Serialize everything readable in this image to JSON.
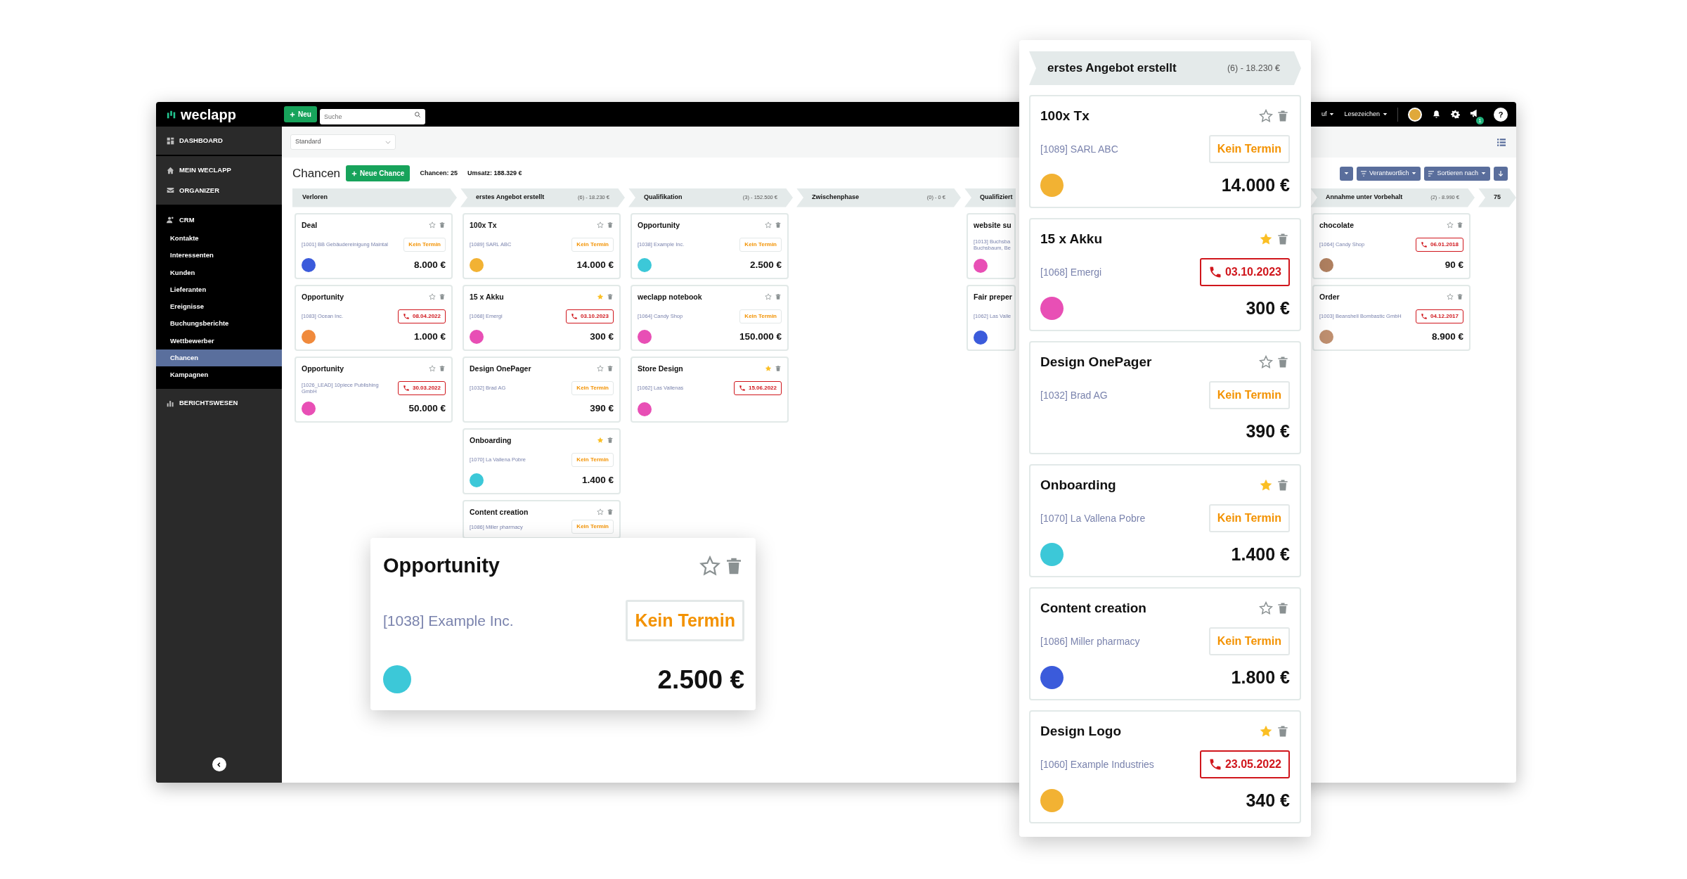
{
  "app": {
    "topbar": {
      "logo": "weclapp",
      "new_button": "Neu",
      "search": {
        "placeholder": "Suche"
      },
      "menus": [
        "uf",
        "Lesezeichen"
      ],
      "announcement_badge": "1",
      "help": "?"
    },
    "sidebar": {
      "groups": [
        {
          "items": [
            {
              "label": "DASHBOARD",
              "selected": false
            }
          ]
        },
        {
          "items": [
            {
              "label": "MEIN WECLAPP",
              "selected": false
            },
            {
              "label": "ORGANIZER",
              "selected": false
            }
          ]
        },
        {
          "items": [
            {
              "label": "CRM",
              "selected": false,
              "expanded": true,
              "children": [
                {
                  "label": "Kontakte",
                  "selected": false
                },
                {
                  "label": "Interessenten",
                  "selected": false
                },
                {
                  "label": "Kunden",
                  "selected": false
                },
                {
                  "label": "Lieferanten",
                  "selected": false
                },
                {
                  "label": "Ereignisse",
                  "selected": false
                },
                {
                  "label": "Buchungsberichte",
                  "selected": false
                },
                {
                  "label": "Wettbewerber",
                  "selected": false
                },
                {
                  "label": "Chancen",
                  "selected": true
                },
                {
                  "label": "Kampagnen",
                  "selected": false
                }
              ]
            }
          ]
        },
        {
          "items": [
            {
              "label": "BERICHTSWESEN",
              "selected": false
            }
          ]
        }
      ]
    },
    "view_select": {
      "value": "Standard"
    },
    "header": {
      "title": "Chancen",
      "new_button": "Neue Chance",
      "stats": [
        "Chancen: 25",
        "Umsatz: 188.329 €"
      ]
    },
    "filters": [
      {
        "kind": "dropdown"
      },
      {
        "kind": "filter",
        "label": "Verantwortlich"
      },
      {
        "kind": "sort",
        "label": "Sortieren nach"
      },
      {
        "kind": "download"
      }
    ],
    "stages": [
      {
        "name": "Verloren",
        "cards": [
          {
            "title": "Deal",
            "company": "[1001] BB Gebäudereinigung Maintal",
            "starred": false,
            "appointment": {
              "kind": "none",
              "text": "Kein Termin"
            },
            "avatar": {
              "color": "#3b5bdb"
            },
            "amount": "8.000 €"
          },
          {
            "title": "Opportunity",
            "company": "[1083] Ocean Inc.",
            "starred": false,
            "appointment": {
              "kind": "call",
              "text": "08.04.2022"
            },
            "avatar": {
              "color": "#f08a3c"
            },
            "amount": "1.000 €"
          },
          {
            "title": "Opportunity",
            "company": "[1026_LEAD] 10piece Publishing GmbH",
            "starred": false,
            "appointment": {
              "kind": "call",
              "text": "30.03.2022"
            },
            "avatar": {
              "color": "#e84fb5"
            },
            "amount": "50.000 €"
          }
        ]
      },
      {
        "name": "erstes Angebot erstellt",
        "summary": "(6) - 18.230 €",
        "cards": [
          {
            "title": "100x Tx",
            "company": "[1089] SARL ABC",
            "starred": false,
            "appointment": {
              "kind": "none",
              "text": "Kein Termin"
            },
            "avatar": {
              "color": "#f2b233"
            },
            "amount": "14.000 €"
          },
          {
            "title": "15 x Akku",
            "company": "[1068] Emergi",
            "starred": true,
            "appointment": {
              "kind": "call",
              "text": "03.10.2023"
            },
            "avatar": {
              "color": "#e84fb5"
            },
            "amount": "300 €"
          },
          {
            "title": "Design OnePager",
            "company": "[1032] Brad AG",
            "starred": false,
            "appointment": {
              "kind": "none",
              "text": "Kein Termin"
            },
            "amount": "390 €"
          },
          {
            "title": "Onboarding",
            "company": "[1070] La Vallena Pobre",
            "starred": true,
            "appointment": {
              "kind": "none",
              "text": "Kein Termin"
            },
            "avatar": {
              "color": "#3cc8d8"
            },
            "amount": "1.400 €"
          },
          {
            "title": "Content creation",
            "company": "[1086] Miller pharmacy",
            "starred": false,
            "appointment": {
              "kind": "none",
              "text": "Kein Termin"
            }
          }
        ]
      },
      {
        "name": "Qualifikation",
        "summary": "(3) - 152.500 €",
        "cards": [
          {
            "title": "Opportunity",
            "company": "[1038] Example Inc.",
            "starred": false,
            "appointment": {
              "kind": "none",
              "text": "Kein Termin"
            },
            "avatar": {
              "color": "#3cc8d8"
            },
            "amount": "2.500 €"
          },
          {
            "title": "weclapp notebook",
            "company": "[1064] Candy Shop",
            "starred": false,
            "appointment": {
              "kind": "none",
              "text": "Kein Termin"
            },
            "avatar": {
              "color": "#e84fb5"
            },
            "amount": "150.000 €"
          },
          {
            "title": "Store Design",
            "company": "[1062] Las Vallenas",
            "starred": true,
            "appointment": {
              "kind": "call",
              "text": "15.06.2022"
            },
            "avatar": {
              "color": "#e84fb5"
            }
          }
        ]
      },
      {
        "name": "Zwischenphase",
        "summary": "(0) - 0 €"
      },
      {
        "name": "Qualifiziert",
        "cards": [
          {
            "title": "website su",
            "company": "[1013] Buchsba\nBuchsbaum, Be",
            "avatar": {
              "color": "#e84fb5"
            }
          },
          {
            "title": "Fair preper",
            "company": "[1062] Las Valle",
            "avatar": {
              "color": "#3b5bdb"
            }
          }
        ]
      },
      {
        "name": "Annahme unter Vorbehalt",
        "summary": "(2) - 8.990 €",
        "cards": [
          {
            "title": "chocolate",
            "company": "[1064] Candy Shop",
            "starred": false,
            "appointment": {
              "kind": "call",
              "text": "06.01.2018"
            },
            "avatar": {
              "color": "#b08060"
            },
            "amount": "90 €"
          },
          {
            "title": "Order",
            "company": "[1003] Beanshell Bombastic GmbH",
            "starred": false,
            "appointment": {
              "kind": "call",
              "text": "04.12.2017"
            },
            "avatar": {
              "color": "#c09070"
            },
            "amount": "8.900 €"
          }
        ]
      },
      {
        "name": "75"
      }
    ]
  },
  "zoom_card": {
    "title": "Opportunity",
    "company": "[1038] Example Inc.",
    "starred": false,
    "appointment": {
      "kind": "none",
      "text": "Kein Termin"
    },
    "avatar": {
      "color": "#3cc8d8"
    },
    "amount": "2.500 €"
  },
  "stage_panel": {
    "name": "erstes Angebot erstellt",
    "summary": "(6) - 18.230 €",
    "cards": [
      {
        "title": "100x Tx",
        "company": "[1089] SARL ABC",
        "starred": false,
        "appointment": {
          "kind": "none",
          "text": "Kein Termin"
        },
        "avatar": {
          "color": "#f2b233"
        },
        "amount": "14.000 €"
      },
      {
        "title": "15 x Akku",
        "company": "[1068] Emergi",
        "starred": true,
        "appointment": {
          "kind": "call",
          "text": "03.10.2023"
        },
        "avatar": {
          "color": "#e84fb5"
        },
        "amount": "300 €"
      },
      {
        "title": "Design OnePager",
        "company": "[1032] Brad AG",
        "starred": false,
        "appointment": {
          "kind": "none",
          "text": "Kein Termin"
        },
        "amount": "390 €"
      },
      {
        "title": "Onboarding",
        "company": "[1070] La Vallena Pobre",
        "starred": true,
        "appointment": {
          "kind": "none",
          "text": "Kein Termin"
        },
        "avatar": {
          "color": "#3cc8d8"
        },
        "amount": "1.400 €"
      },
      {
        "title": "Content creation",
        "company": "[1086] Miller pharmacy",
        "starred": false,
        "appointment": {
          "kind": "none",
          "text": "Kein Termin"
        },
        "avatar": {
          "color": "#3b5bdb"
        },
        "amount": "1.800 €"
      },
      {
        "title": "Design Logo",
        "company": "[1060] Example Industries",
        "starred": true,
        "appointment": {
          "kind": "call",
          "text": "23.05.2022"
        },
        "avatar": {
          "color": "#f2b233"
        },
        "amount": "340 €"
      }
    ]
  }
}
